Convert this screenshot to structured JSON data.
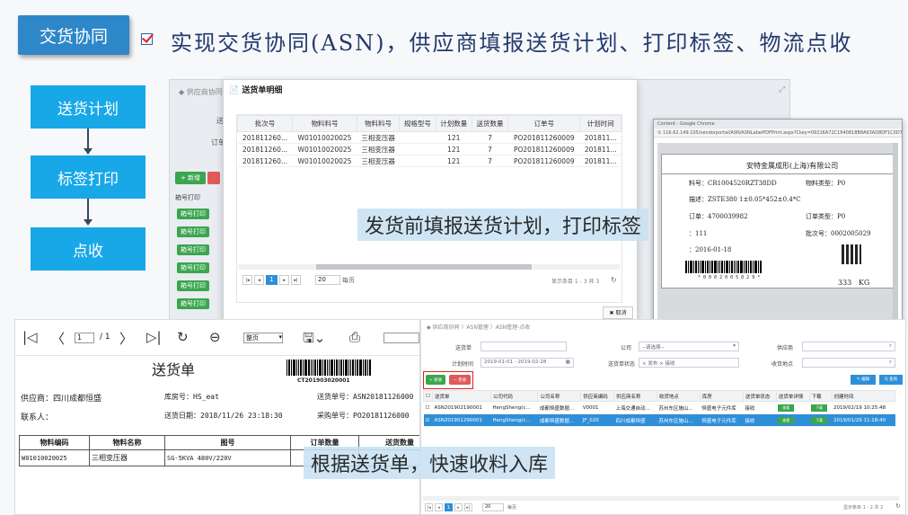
{
  "header": {
    "tag": "交货协同",
    "title": "实现交货协同(ASN)，供应商填报送货计划、打印标签、物流点收"
  },
  "flow": {
    "steps": [
      "送货计划",
      "标签打印",
      "点收"
    ]
  },
  "app1": {
    "crumb": "◆ 供应商协同 〉",
    "add_button": "+ 新增",
    "list_header": "箱号打印",
    "row_button": "箱号打印"
  },
  "modal": {
    "title": "送货单明细",
    "columns": [
      "批次号",
      "物料料号",
      "物料料号",
      "规格型号",
      "计划数量",
      "送货数量",
      "订单号",
      "计划时间"
    ],
    "rows": [
      [
        "20181126​0...",
        "W01010020025",
        "三相变压器",
        "",
        "121",
        "7",
        "PO201811260009",
        "201811..."
      ],
      [
        "20181126​0...",
        "W01010020025",
        "三相变压器",
        "",
        "121",
        "7",
        "PO201811260009",
        "201811..."
      ],
      [
        "20181126​0...",
        "W01010020025",
        "三相变压器",
        "",
        "121",
        "7",
        "PO201811260009",
        "201811..."
      ]
    ],
    "pager": {
      "current_page": "1",
      "page_size": "20",
      "per_page_label": "每页",
      "summary": "显示条目 1 - 3 共 3"
    },
    "cancel_button": "✖ 取消"
  },
  "chrome": {
    "tab_title": "Content - Google Chrome",
    "url": "① 116.62.149.105/vendorportal/ASN/ASNLabelPDFPrint.aspx?Ckey=09216A72C1640818B8A63AD8DF1C0D7744...",
    "label": {
      "company": "安特金属成形(上海)有限公司",
      "part_no_label": "料号：",
      "part_no": "CR1004520RZT38DD",
      "material_type_label": "物料类型：",
      "material_type": "P0",
      "desc_label": "描述：",
      "desc": "ZSTE380 1±0.05*452±0.4*C",
      "order_label": "订单：",
      "order": "4700039982",
      "order_type_label": "订单类型：",
      "order_type": "P0",
      "qty_prefix": "：",
      "qty": "111",
      "batch_label": "批次号：",
      "batch": "0002005029",
      "date_prefix": "：",
      "date": "2016-01-18",
      "barcode_text": "* 0 0 0 2 0 0 5 0 2 9 *",
      "weight": "333",
      "unit": "KG"
    }
  },
  "callouts": {
    "first": "发货前填报送货计划，打印标签",
    "second": "根据送货单，快速收料入库"
  },
  "note": {
    "toolbar": {
      "page_value": "1",
      "page_total": "/ 1",
      "zoom": "整页"
    },
    "title": "送货单",
    "barcode_text": "CT201903020001",
    "supplier_label": "供应商：",
    "supplier": "四川成都恒盛",
    "warehouse_label": "库房号：",
    "warehouse": "HS_eat",
    "asn_label": "送货单号：",
    "asn": "ASN20181126000",
    "contact_label": "联系人：",
    "delivery_date_label": "送货日期：",
    "delivery_date": "2018/11/26 23:18:30",
    "po_label": "采购单号：",
    "po": "PO20181126000",
    "columns": [
      "物料编码",
      "物料名称",
      "图号",
      "订单数量",
      "送货数量"
    ],
    "row": [
      "W01010020025",
      "三相变压器",
      "SG-5KVA 480V/220V",
      "",
      ""
    ]
  },
  "recv": {
    "crumb": "◆ 供应商协同 〉ASN管理 〉ASN管理-点收",
    "asn_label": "送货单",
    "company_label": "公司",
    "company_placeholder": "--请选择--",
    "supplier_label": "供应商",
    "plan_time_label": "计划时间",
    "plan_time": "2019-01-01 - 2019-02-28",
    "status_label": "送货单状态",
    "status_value": "× 发布  × 接收",
    "location_label": "收货地点",
    "btn_add": "+ 接收",
    "btn_del": "− 拒收",
    "btn_edit": "✎ 编辑",
    "btn_query": "Q 查询",
    "columns": [
      "送货单",
      "公司代码",
      "公司名称",
      "供应商编码",
      "供应商名称",
      "收货地点",
      "库房",
      "送货单状态",
      "送货单详情",
      "下载",
      "创建时间"
    ],
    "rows": [
      [
        "ASN201902190001",
        "HengSheng(c...",
        "成都恒盛数据...",
        "V0001",
        "上海交通自动...",
        "苏州东区施山...",
        "恒盛电子元件库",
        "接收",
        "查看",
        "下载",
        "2019/02/19 10:25:48"
      ],
      [
        "ASN201901290001",
        "HengSheng(c...",
        "成都恒盛数据...",
        "JF_020",
        "四川成都恒盛",
        "苏州东区施山...",
        "恒盛电子元件库",
        "接收",
        "查看",
        "下载",
        "2019/01/29 11:18:40"
      ]
    ],
    "pager": {
      "current_page": "1",
      "page_size": "20",
      "per_page_label": "每页",
      "summary": "显示条目 1 - 2 共 2"
    }
  }
}
